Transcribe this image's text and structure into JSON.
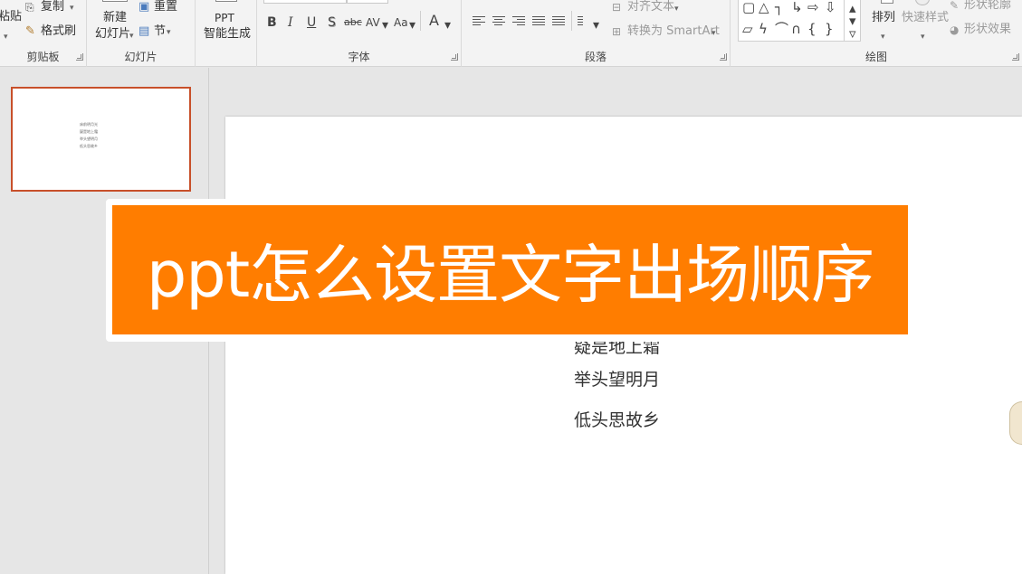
{
  "ribbon": {
    "clipboard": {
      "paste_label": "粘贴",
      "copy_label": "复制",
      "format_painter_label": "格式刷",
      "group_label": "剪贴板"
    },
    "slides": {
      "new_slide_line1": "新建",
      "new_slide_line2": "幻灯片",
      "reset_label": "重置",
      "section_label": "节",
      "group_label": "幻灯片"
    },
    "ppt_ai": {
      "line1": "PPT",
      "line2": "智能生成"
    },
    "font": {
      "bold": "B",
      "italic": "I",
      "underline": "U",
      "shadow": "S",
      "strikethrough": "abc",
      "spacing": "AV",
      "change_case": "Aa",
      "font_color": "A",
      "group_label": "字体"
    },
    "paragraph": {
      "align_text_label": "对齐文本",
      "smartart_label": "转换为 SmartArt",
      "group_label": "段落"
    },
    "drawing": {
      "arrange_label": "排列",
      "quick_styles_label": "快速样式",
      "shape_outline_label": "形状轮廓",
      "shape_effects_label": "形状效果",
      "group_label": "绘图"
    }
  },
  "thumbnail": {
    "lines": [
      "床前明月光",
      "疑是地上霜",
      "举头望明月",
      "低头思故乡"
    ]
  },
  "slide": {
    "partial_line": "疑是地上霜",
    "line3": "举头望明月",
    "line4": "低头思故乡"
  },
  "banner": {
    "title": "ppt怎么设置文字出场顺序",
    "color": "#ff7d00"
  },
  "colors": {
    "selection_border": "#c8502a",
    "ribbon_bg": "#f3f3f3"
  }
}
